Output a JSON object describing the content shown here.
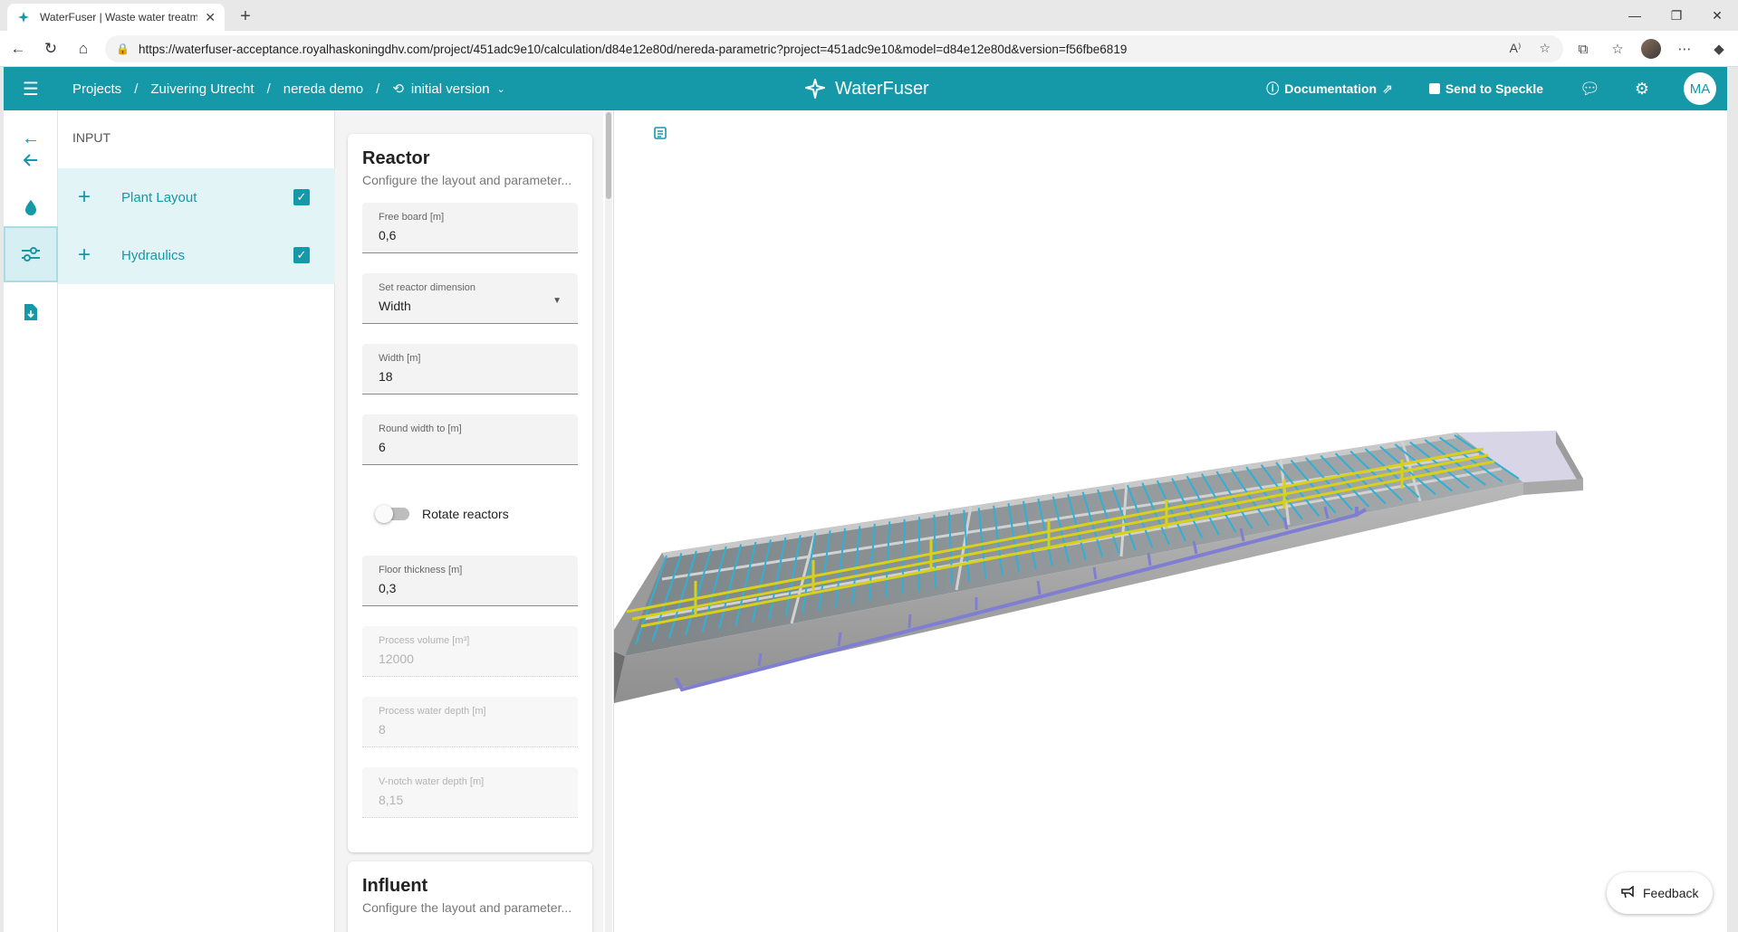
{
  "browser": {
    "tab_title": "WaterFuser | Waste water treatme",
    "url": "https://waterfuser-acceptance.royalhaskoningdhv.com/project/451adc9e10/calculation/d84e12e80d/nereda-parametric?project=451adc9e10&model=d84e12e80d&version=f56fbe6819"
  },
  "header": {
    "breadcrumbs": [
      "Projects",
      "Zuivering Utrecht",
      "nereda demo"
    ],
    "version": "initial version",
    "brand": "WaterFuser",
    "documentation": "Documentation",
    "send_to_speckle": "Send to Speckle",
    "avatar": "MA",
    "accent": "#1598a8"
  },
  "input": {
    "header": "INPUT",
    "groups": [
      {
        "label": "Plant Layout",
        "checked": true
      },
      {
        "label": "Hydraulics",
        "checked": true
      }
    ]
  },
  "reactor": {
    "title": "Reactor",
    "subtitle": "Configure the layout and parameter...",
    "fields": {
      "free_board": {
        "label": "Free board [m]",
        "value": "0,6"
      },
      "dimension": {
        "label": "Set reactor dimension",
        "value": "Width"
      },
      "width": {
        "label": "Width [m]",
        "value": "18"
      },
      "round_width": {
        "label": "Round width to [m]",
        "value": "6"
      },
      "floor_thickness": {
        "label": "Floor thickness [m]",
        "value": "0,3"
      },
      "process_volume": {
        "label": "Process volume [m³]",
        "value": "12000"
      },
      "process_depth": {
        "label": "Process water depth [m]",
        "value": "8"
      },
      "vnotch_depth": {
        "label": "V-notch water depth [m]",
        "value": "8,15"
      }
    },
    "rotate_reactors": "Rotate reactors",
    "rotate_on": false
  },
  "influent": {
    "title": "Influent",
    "subtitle": "Configure the layout and parameter..."
  },
  "viewport": {
    "feedback": "Feedback"
  }
}
